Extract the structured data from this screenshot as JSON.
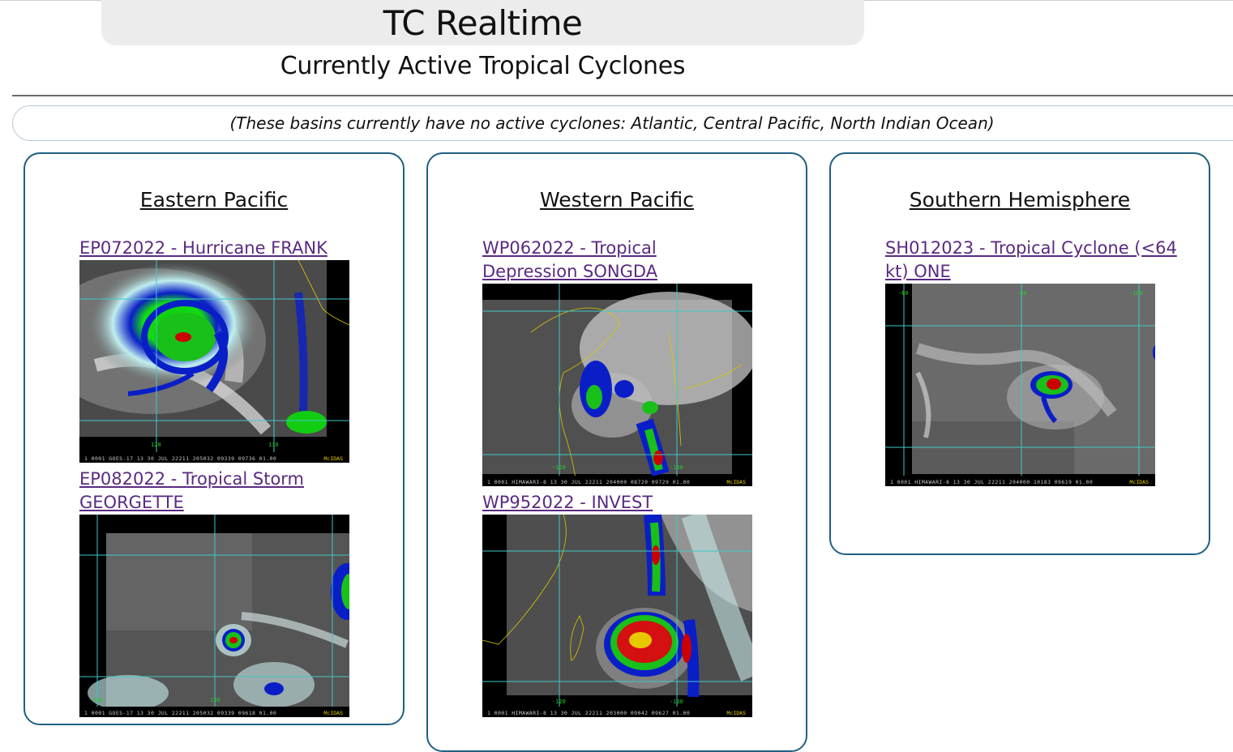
{
  "header": {
    "title": "TC Realtime",
    "subtitle": "Currently Active Tropical Cyclones"
  },
  "notice": "(These basins currently have no active cyclones: Atlantic, Central Pacific, North Indian Ocean)",
  "colors": {
    "basin_border": "#1f5f82",
    "link": "#5a2a82",
    "title_bg": "#ececec"
  },
  "basins": [
    {
      "name": "Eastern Pacific",
      "storms": [
        {
          "link": "EP072022 - Hurricane FRANK",
          "image_caption": "1 0001 GOES-17    13 30 JUL 22211 205032 09339 09736 01.00",
          "image_brand": "McIDAS",
          "lon_labels": [
            "120",
            "110"
          ]
        },
        {
          "link": "EP082022 - Tropical Storm GEORGETTE",
          "image_caption": "1 0001 GOES-17    13 30 JUL 22211 205032 09339 09618 01.00",
          "image_brand": "McIDAS",
          "lon_labels": [
            "140",
            "130"
          ]
        }
      ]
    },
    {
      "name": "Western Pacific",
      "storms": [
        {
          "link": "WP062022 - Tropical Depression SONGDA",
          "image_caption": "1 0001 HIMAWARI-8 13 30 JUL 22211 204000 08720 09729 01.00",
          "image_brand": "McIDAS",
          "lon_labels": [
            "-120",
            "-130"
          ]
        },
        {
          "link": "WP952022 - INVEST",
          "image_caption": "1 0001 HIMAWARI-8 13 30 JUL 22211 203000 09042 09627 01.00",
          "image_brand": "McIDAS",
          "lon_labels": [
            "-120",
            "-130"
          ]
        }
      ]
    },
    {
      "name": "Southern Hemisphere",
      "storms": [
        {
          "link": "SH012023 - Tropical Cyclone (<64 kt) ONE",
          "image_caption": "1 0001 HIMAWARI-8 13 30 JUL 22211 204000 10183 09619 01.00",
          "image_brand": "McIDAS",
          "lon_labels": [
            "-80",
            "-90",
            "-100"
          ]
        }
      ]
    }
  ]
}
